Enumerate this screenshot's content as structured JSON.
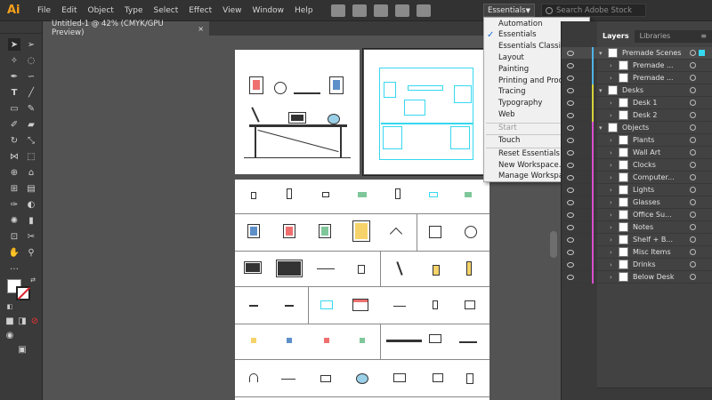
{
  "app": {
    "logo": "Ai"
  },
  "menubar": {
    "items": [
      "File",
      "Edit",
      "Object",
      "Type",
      "Select",
      "Effect",
      "View",
      "Window",
      "Help"
    ],
    "workspace_button": "Essentials",
    "search_placeholder": "Search Adobe Stock"
  },
  "document": {
    "tab_title": "Untitled-1 @ 42% (CMYK/GPU Preview)",
    "close_glyph": "×"
  },
  "workspace_menu": {
    "items": [
      {
        "label": "Automation",
        "checked": false,
        "disabled": false
      },
      {
        "label": "Essentials",
        "checked": true,
        "disabled": false
      },
      {
        "label": "Essentials Classic",
        "checked": false,
        "disabled": false
      },
      {
        "label": "Layout",
        "checked": false,
        "disabled": false
      },
      {
        "label": "Painting",
        "checked": false,
        "disabled": false
      },
      {
        "label": "Printing and Proofing",
        "checked": false,
        "disabled": false
      },
      {
        "label": "Tracing",
        "checked": false,
        "disabled": false
      },
      {
        "label": "Typography",
        "checked": false,
        "disabled": false
      },
      {
        "label": "Web",
        "checked": false,
        "disabled": false
      },
      {
        "label": "Start",
        "checked": false,
        "disabled": true
      },
      {
        "label": "Touch",
        "checked": false,
        "disabled": false
      },
      {
        "label": "Reset Essentials",
        "checked": false,
        "disabled": false
      },
      {
        "label": "New Workspace...",
        "checked": false,
        "disabled": false
      },
      {
        "label": "Manage Workspaces...",
        "checked": false,
        "disabled": false
      }
    ]
  },
  "layers_panel": {
    "tabs": [
      "Layers",
      "Libraries"
    ],
    "active_tab": "Layers",
    "rows": [
      {
        "name": "Premade Scenes",
        "level": 0,
        "expanded": true,
        "color": "#4fb3e8",
        "selected": true
      },
      {
        "name": "Premade ...",
        "level": 1,
        "expanded": false,
        "color": "#4fb3e8",
        "selected": false
      },
      {
        "name": "Premade ...",
        "level": 1,
        "expanded": false,
        "color": "#4fb3e8",
        "selected": false
      },
      {
        "name": "Desks",
        "level": 0,
        "expanded": true,
        "color": "#d6d23c",
        "selected": false
      },
      {
        "name": "Desk 1",
        "level": 1,
        "expanded": false,
        "color": "#d6d23c",
        "selected": false
      },
      {
        "name": "Desk 2",
        "level": 1,
        "expanded": false,
        "color": "#d6d23c",
        "selected": false
      },
      {
        "name": "Objects",
        "level": 0,
        "expanded": true,
        "color": "#d94fd0",
        "selected": false
      },
      {
        "name": "Plants",
        "level": 1,
        "expanded": false,
        "color": "#d94fd0",
        "selected": false
      },
      {
        "name": "Wall Art",
        "level": 1,
        "expanded": false,
        "color": "#d94fd0",
        "selected": false
      },
      {
        "name": "Clocks",
        "level": 1,
        "expanded": false,
        "color": "#d94fd0",
        "selected": false
      },
      {
        "name": "Computer...",
        "level": 1,
        "expanded": false,
        "color": "#d94fd0",
        "selected": false
      },
      {
        "name": "Lights",
        "level": 1,
        "expanded": false,
        "color": "#d94fd0",
        "selected": false
      },
      {
        "name": "Glasses",
        "level": 1,
        "expanded": false,
        "color": "#d94fd0",
        "selected": false
      },
      {
        "name": "Office Su...",
        "level": 1,
        "expanded": false,
        "color": "#d94fd0",
        "selected": false
      },
      {
        "name": "Notes",
        "level": 1,
        "expanded": false,
        "color": "#d94fd0",
        "selected": false
      },
      {
        "name": "Shelf + B...",
        "level": 1,
        "expanded": false,
        "color": "#d94fd0",
        "selected": false
      },
      {
        "name": "Misc Items",
        "level": 1,
        "expanded": false,
        "color": "#d94fd0",
        "selected": false
      },
      {
        "name": "Drinks",
        "level": 1,
        "expanded": false,
        "color": "#d94fd0",
        "selected": false
      },
      {
        "name": "Below Desk",
        "level": 1,
        "expanded": false,
        "color": "#d94fd0",
        "selected": false
      }
    ]
  }
}
